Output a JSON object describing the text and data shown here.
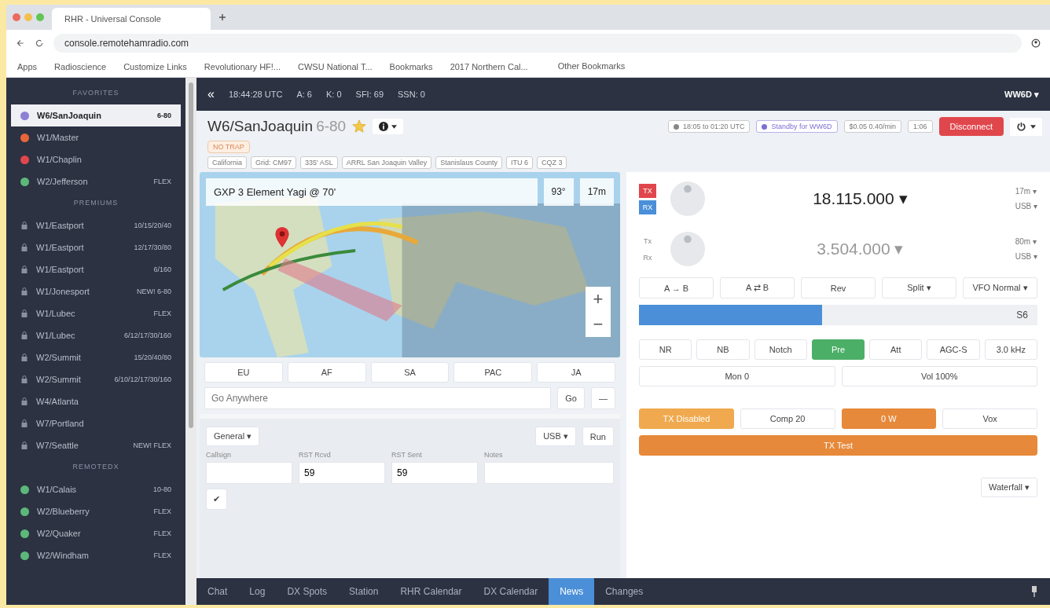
{
  "browser": {
    "tab_title": "RHR - Universal Console",
    "url": "console.remotehamradio.com",
    "bookmarks": [
      "Apps",
      "Radioscience",
      "Customize Links",
      "Revolutionary HF!...",
      "CWSU National T...",
      "Bookmarks",
      "2017 Northern Cal..."
    ],
    "other_bookmarks": "Other Bookmarks"
  },
  "sidebar": {
    "sections": [
      {
        "title": "FAVORITES",
        "kind": "dot",
        "items": [
          {
            "name": "W6/SanJoaquin",
            "tag": "6-80",
            "color": "#8e7fd6",
            "selected": true
          },
          {
            "name": "W1/Master",
            "color": "#e8663a",
            "selected": false
          },
          {
            "name": "W1/Chaplin",
            "color": "#e0474c",
            "selected": false
          },
          {
            "name": "W2/Jefferson",
            "tag": "FLEX",
            "color": "#5cb87a",
            "selected": false
          }
        ]
      },
      {
        "title": "PREMIUMS",
        "kind": "lock",
        "items": [
          {
            "name": "W1/Eastport",
            "tag": "10/15/20/40",
            "selected": false
          },
          {
            "name": "W1/Eastport",
            "tag": "12/17/30/80",
            "selected": false
          },
          {
            "name": "W1/Eastport",
            "tag": "6/160",
            "selected": false
          },
          {
            "name": "W1/Jonesport",
            "tag": "NEW! 6-80",
            "selected": false
          },
          {
            "name": "W1/Lubec",
            "tag": "FLEX",
            "selected": false
          },
          {
            "name": "W1/Lubec",
            "tag": "6/12/17/30/160",
            "selected": false
          },
          {
            "name": "W2/Summit",
            "tag": "15/20/40/80",
            "selected": false
          },
          {
            "name": "W2/Summit",
            "tag": "6/10/12/17/30/160",
            "selected": false
          },
          {
            "name": "W4/Atlanta",
            "selected": false
          },
          {
            "name": "W7/Portland",
            "selected": false
          },
          {
            "name": "W7/Seattle",
            "tag": "NEW! FLEX",
            "selected": false
          }
        ]
      },
      {
        "title": "REMOTEDX",
        "kind": "dot",
        "items": [
          {
            "name": "W1/Calais",
            "tag": "10-80",
            "color": "#5cb87a",
            "selected": false
          },
          {
            "name": "W2/Blueberry",
            "tag": "FLEX",
            "color": "#5cb87a",
            "selected": false
          },
          {
            "name": "W2/Quaker",
            "tag": "FLEX",
            "color": "#5cb87a",
            "selected": false
          },
          {
            "name": "W2/Windham",
            "tag": "FLEX",
            "color": "#5cb87a",
            "selected": false
          }
        ]
      }
    ]
  },
  "topbar": {
    "collapse": "«",
    "stats": [
      "18:44:28 UTC",
      "A: 6",
      "K: 0",
      "SFI: 69",
      "SSN: 0"
    ],
    "user": "WW6D ▾"
  },
  "station": {
    "name": "W6/SanJoaquin",
    "bands": "6-80",
    "favorite": true,
    "badges": [
      {
        "text": "18:05 to 01:20 UTC",
        "kind": "clock"
      },
      {
        "text": "Standby for WW6D",
        "kind": "standby"
      },
      {
        "text": "$0.05 0.40/min",
        "kind": "plain"
      },
      {
        "text": "1:06",
        "kind": "plain"
      }
    ],
    "disconnect": "Disconnect",
    "alert": "NO TRAP",
    "tags": [
      "California",
      "Grid: CM97",
      "335' ASL",
      "ARRL San Joaquin Valley",
      "Stanislaus County",
      "ITU 6",
      "CQZ 3"
    ]
  },
  "map": {
    "antenna": "GXP 3 Element Yagi @ 70'",
    "bearing": "93°",
    "band": "17m",
    "zoom_in": "+",
    "zoom_out": "−",
    "regions": [
      "EU",
      "AF",
      "SA",
      "PAC",
      "JA"
    ],
    "placeholder": "Go Anywhere",
    "go": "Go",
    "minus": "—"
  },
  "log": {
    "type": "General ▾",
    "mode": "USB ▾",
    "run": "Run",
    "fields": [
      {
        "label": "Callsign"
      },
      {
        "label": "RST Rcvd",
        "value": "59"
      },
      {
        "label": "RST Sent",
        "value": "59"
      },
      {
        "label": "Notes"
      }
    ],
    "submit": "✔"
  },
  "bottom_tabs": [
    {
      "label": "Chat",
      "selected": false
    },
    {
      "label": "Log",
      "selected": false
    },
    {
      "label": "DX Spots",
      "selected": false
    },
    {
      "label": "Station",
      "selected": false
    },
    {
      "label": "RHR Calendar",
      "selected": false
    },
    {
      "label": "DX Calendar",
      "selected": false
    },
    {
      "label": "News",
      "selected": true
    },
    {
      "label": "Changes",
      "selected": false
    }
  ],
  "radio": {
    "vfos": [
      {
        "tx_label": "TX",
        "rx_label": "RX",
        "active": true,
        "frequency": "18.115.000 ▾",
        "band": "17m ▾",
        "mode": "USB ▾"
      },
      {
        "tx_label": "Tx",
        "rx_label": "Rx",
        "active": false,
        "frequency": "3.504.000 ▾",
        "band": "80m ▾",
        "mode": "USB ▾"
      }
    ],
    "vfo_buttons": [
      "A → B",
      "A ⇄ B",
      "Rev",
      "Split ▾",
      "VFO Normal ▾"
    ],
    "meter": {
      "level": 0.46,
      "reading": "S6"
    },
    "filters": [
      {
        "label": "NR",
        "on": false
      },
      {
        "label": "NB",
        "on": false
      },
      {
        "label": "Notch",
        "on": false
      },
      {
        "label": "Pre",
        "on": true
      },
      {
        "label": "Att",
        "on": false
      },
      {
        "label": "AGC-S",
        "on": false
      },
      {
        "label": "3.0 kHz",
        "on": false
      }
    ],
    "audio": [
      "Mon 0",
      "Vol 100%"
    ],
    "tx_buttons": [
      {
        "label": "TX Disabled",
        "kind": "light"
      },
      {
        "label": "Comp 20",
        "kind": "plain"
      },
      {
        "label": "0 W",
        "kind": "strong"
      },
      {
        "label": "Vox",
        "kind": "plain"
      }
    ],
    "tx_test": "TX Test",
    "waterfall": "Waterfall ▾"
  }
}
